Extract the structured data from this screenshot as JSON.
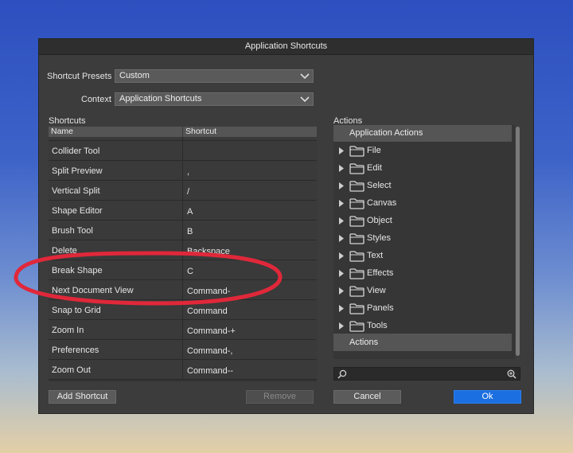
{
  "dialog": {
    "title": "Application Shortcuts"
  },
  "presets": {
    "label": "Shortcut Presets",
    "value": "Custom"
  },
  "context": {
    "label": "Context",
    "value": "Application Shortcuts"
  },
  "shortcuts": {
    "section_label": "Shortcuts",
    "columns": [
      "Name",
      "Shortcut"
    ],
    "rows": [
      {
        "name": "Collider Tool",
        "shortcut": ""
      },
      {
        "name": "Split Preview",
        "shortcut": ","
      },
      {
        "name": "Vertical Split",
        "shortcut": "/"
      },
      {
        "name": "Shape Editor",
        "shortcut": "A"
      },
      {
        "name": "Brush Tool",
        "shortcut": "B"
      },
      {
        "name": "Delete",
        "shortcut": "Backspace"
      },
      {
        "name": "Break Shape",
        "shortcut": "C"
      },
      {
        "name": "Next Document View",
        "shortcut": "Command-"
      },
      {
        "name": "Snap to Grid",
        "shortcut": "Command"
      },
      {
        "name": "Zoom In",
        "shortcut": "Command-+"
      },
      {
        "name": "Preferences",
        "shortcut": "Command-,"
      },
      {
        "name": "Zoom Out",
        "shortcut": "Command--"
      }
    ]
  },
  "actions": {
    "section_label": "Actions",
    "header": "Application Actions",
    "items": [
      "File",
      "Edit",
      "Select",
      "Canvas",
      "Object",
      "Styles",
      "Text",
      "Effects",
      "View",
      "Panels",
      "Tools"
    ],
    "footer": "Actions"
  },
  "buttons": {
    "add_shortcut": "Add Shortcut",
    "remove": "Remove",
    "cancel": "Cancel",
    "ok": "Ok"
  },
  "icons": {
    "search": "search-icon",
    "zoom": "zoom-icon",
    "folder": "folder-icon",
    "arrow": "triangle-right-icon",
    "chevron": "chevron-down-icon"
  },
  "colors": {
    "primary_button": "#1b6fe0",
    "annotation": "#e0283a"
  }
}
